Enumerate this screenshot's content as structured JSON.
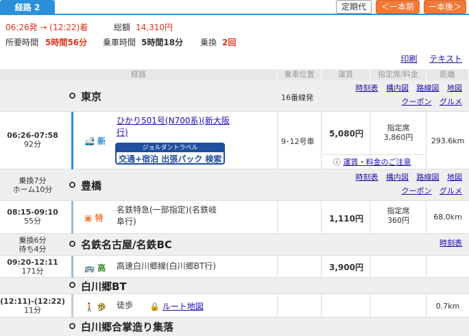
{
  "tabbar": {
    "route_tab": "経路 2",
    "commuter_pass": "定期代",
    "prev": "＜一本前",
    "next": "一本後＞"
  },
  "summary": {
    "time_range": "06:26発 → (12:22)着",
    "total_label": "総額",
    "total_value": "14,310円",
    "duration_label": "所要時間",
    "duration_value": "5時間56分",
    "ride_label": "乗車時間",
    "ride_value": "5時間18分",
    "transfer_label": "乗換",
    "transfer_value": "2回"
  },
  "toplinks": {
    "print": "印刷",
    "text": "テキスト"
  },
  "header": {
    "route": "経路",
    "position": "乗車位置",
    "fare": "運賃",
    "reserved": "指定席/料金",
    "distance": "距離"
  },
  "stations": [
    {
      "name": "東京",
      "extra": "16番線発"
    },
    {
      "name": "豊橋"
    },
    {
      "name": "名鉄名古屋/名鉄BC"
    },
    {
      "name": "白川郷BT"
    },
    {
      "name": "白川郷合掌造り集落"
    }
  ],
  "station_links": {
    "timetable": "時刻表",
    "map_in": "構内図",
    "route_map": "路線図",
    "map": "地図",
    "coupon": "クーポン",
    "gourmet": "グルメ"
  },
  "segments": [
    {
      "time": "06:26-07:58",
      "dur": "92分",
      "mode_label": "新",
      "service_line1": "ひかり501号(N700系)(新大阪",
      "service_line2": "行)",
      "position": "9･12号車",
      "fare": "5,080円",
      "reserved_label": "指定席",
      "reserved_fee": "3,860円",
      "distance": "293.6km",
      "fare_link": "運賃・料金のご注意",
      "banner_top": "ジョルダントラベル",
      "banner_main": "交通+宿泊 出張パック 検索"
    },
    {
      "time": "08:15-09:10",
      "dur": "55分",
      "mode_label": "特",
      "service_line1": "名鉄特急(一部指定)(名鉄岐",
      "service_line2": "阜行)",
      "fare": "1,110円",
      "reserved_label": "指定席",
      "reserved_fee": "360円",
      "distance": "68.0km"
    },
    {
      "time": "09:20-12:11",
      "dur": "171分",
      "mode_label": "高",
      "service_line1": "高速白川郷線(白川郷BT行)",
      "fare": "3,900円"
    },
    {
      "time": "(12:11)-(12:22)",
      "dur": "11分",
      "mode_label": "歩",
      "service_line1": "徒歩",
      "route_map_link": "ルート地図",
      "distance": "0.7km"
    }
  ],
  "transfers": [
    {
      "line1": "乗換7分",
      "line2": "ホーム10分"
    },
    {
      "line1": "乗換6分",
      "line2": "待ち4分"
    }
  ]
}
